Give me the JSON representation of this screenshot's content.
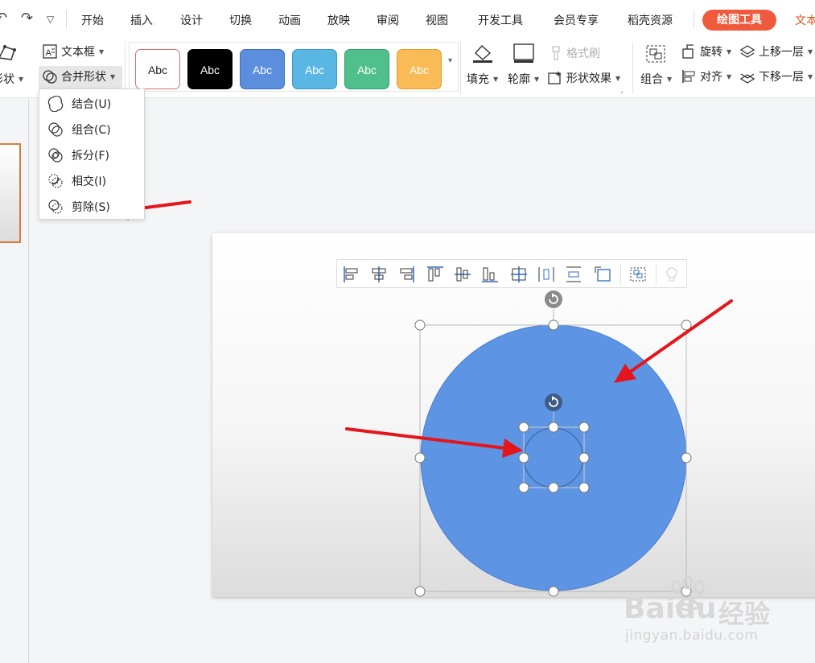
{
  "quick_access": {
    "undo_icon": "undo-icon",
    "redo_icon": "redo-icon",
    "more_icon": "chevron-down-icon"
  },
  "menu_tabs": [
    {
      "label": "开始"
    },
    {
      "label": "插入"
    },
    {
      "label": "设计"
    },
    {
      "label": "切换"
    },
    {
      "label": "动画"
    },
    {
      "label": "放映"
    },
    {
      "label": "审阅"
    },
    {
      "label": "视图"
    },
    {
      "label": "开发工具"
    },
    {
      "label": "会员专享"
    },
    {
      "label": "稻壳资源"
    }
  ],
  "active_tab": {
    "label": "绘图工具",
    "color": "#f05a3c"
  },
  "context_tab": {
    "label": "文本"
  },
  "ribbon": {
    "edit_shape_label": "形状",
    "text_box_label": "文本框",
    "merge_shapes_label": "合并形状",
    "style_gallery": [
      {
        "label": "Abc",
        "fill": "#ffffff",
        "border": "#e06a6a",
        "text": "#222222"
      },
      {
        "label": "Abc",
        "fill": "#000000",
        "border": "#000000",
        "text": "#ffffff"
      },
      {
        "label": "Abc",
        "fill": "#5b8fdd",
        "border": "#3d6fc0",
        "text": "#ffffff"
      },
      {
        "label": "Abc",
        "fill": "#5ab7e3",
        "border": "#3a98c6",
        "text": "#ffffff"
      },
      {
        "label": "Abc",
        "fill": "#4fc08c",
        "border": "#2fa06c",
        "text": "#ffffff"
      },
      {
        "label": "Abc",
        "fill": "#f9bb55",
        "border": "#e39a2a",
        "text": "#ffffff"
      }
    ],
    "fill_label": "填充",
    "outline_label": "轮廓",
    "format_painter_label": "格式刷",
    "shape_effects_label": "形状效果",
    "group_label": "组合",
    "rotate_label": "旋转",
    "align_label": "对齐",
    "bring_forward_label": "上移一层",
    "send_backward_label": "下移一层"
  },
  "merge_menu": {
    "items": [
      {
        "label": "结合(U)",
        "icon": "union-icon"
      },
      {
        "label": "组合(C)",
        "icon": "combine-icon"
      },
      {
        "label": "拆分(F)",
        "icon": "fragment-icon"
      },
      {
        "label": "相交(I)",
        "icon": "intersect-icon"
      },
      {
        "label": "剪除(S)",
        "icon": "subtract-icon"
      }
    ]
  },
  "slide": {
    "big_circle_color": "#5d94e3",
    "align_toolbar_icons": [
      "align-left-icon",
      "align-center-icon",
      "align-right-icon",
      "align-top-icon",
      "align-middle-icon",
      "align-bottom-icon",
      "align-horizontal-center-icon",
      "distribute-horizontal-icon",
      "distribute-vertical-icon",
      "fit-slide-icon",
      "group-icon",
      "lightbulb-icon"
    ]
  },
  "annotation_color": "#e5161b",
  "watermark": {
    "brand": "Baidu",
    "cn": "经验",
    "url": "jingyan.baidu.com"
  }
}
